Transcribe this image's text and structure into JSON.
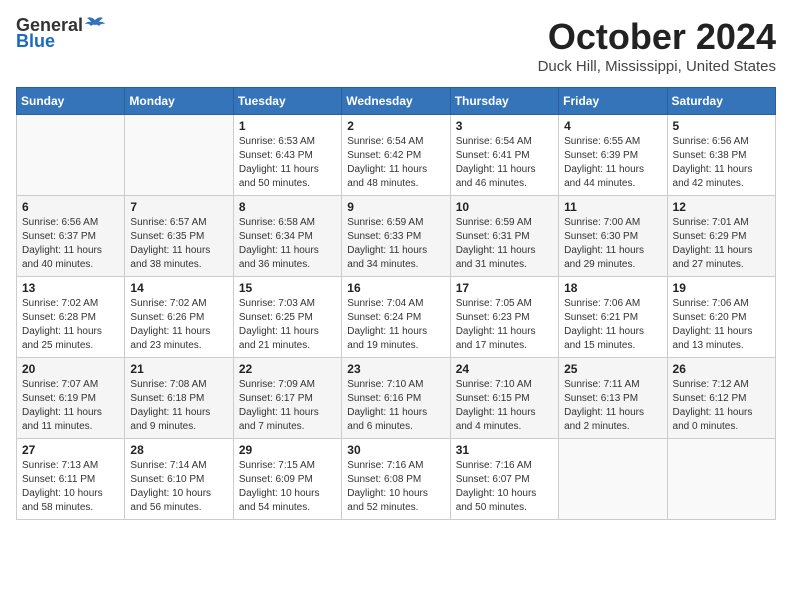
{
  "header": {
    "logo_general": "General",
    "logo_blue": "Blue",
    "month": "October 2024",
    "location": "Duck Hill, Mississippi, United States"
  },
  "weekdays": [
    "Sunday",
    "Monday",
    "Tuesday",
    "Wednesday",
    "Thursday",
    "Friday",
    "Saturday"
  ],
  "weeks": [
    [
      {
        "day": "",
        "info": ""
      },
      {
        "day": "",
        "info": ""
      },
      {
        "day": "1",
        "info": "Sunrise: 6:53 AM\nSunset: 6:43 PM\nDaylight: 11 hours and 50 minutes."
      },
      {
        "day": "2",
        "info": "Sunrise: 6:54 AM\nSunset: 6:42 PM\nDaylight: 11 hours and 48 minutes."
      },
      {
        "day": "3",
        "info": "Sunrise: 6:54 AM\nSunset: 6:41 PM\nDaylight: 11 hours and 46 minutes."
      },
      {
        "day": "4",
        "info": "Sunrise: 6:55 AM\nSunset: 6:39 PM\nDaylight: 11 hours and 44 minutes."
      },
      {
        "day": "5",
        "info": "Sunrise: 6:56 AM\nSunset: 6:38 PM\nDaylight: 11 hours and 42 minutes."
      }
    ],
    [
      {
        "day": "6",
        "info": "Sunrise: 6:56 AM\nSunset: 6:37 PM\nDaylight: 11 hours and 40 minutes."
      },
      {
        "day": "7",
        "info": "Sunrise: 6:57 AM\nSunset: 6:35 PM\nDaylight: 11 hours and 38 minutes."
      },
      {
        "day": "8",
        "info": "Sunrise: 6:58 AM\nSunset: 6:34 PM\nDaylight: 11 hours and 36 minutes."
      },
      {
        "day": "9",
        "info": "Sunrise: 6:59 AM\nSunset: 6:33 PM\nDaylight: 11 hours and 34 minutes."
      },
      {
        "day": "10",
        "info": "Sunrise: 6:59 AM\nSunset: 6:31 PM\nDaylight: 11 hours and 31 minutes."
      },
      {
        "day": "11",
        "info": "Sunrise: 7:00 AM\nSunset: 6:30 PM\nDaylight: 11 hours and 29 minutes."
      },
      {
        "day": "12",
        "info": "Sunrise: 7:01 AM\nSunset: 6:29 PM\nDaylight: 11 hours and 27 minutes."
      }
    ],
    [
      {
        "day": "13",
        "info": "Sunrise: 7:02 AM\nSunset: 6:28 PM\nDaylight: 11 hours and 25 minutes."
      },
      {
        "day": "14",
        "info": "Sunrise: 7:02 AM\nSunset: 6:26 PM\nDaylight: 11 hours and 23 minutes."
      },
      {
        "day": "15",
        "info": "Sunrise: 7:03 AM\nSunset: 6:25 PM\nDaylight: 11 hours and 21 minutes."
      },
      {
        "day": "16",
        "info": "Sunrise: 7:04 AM\nSunset: 6:24 PM\nDaylight: 11 hours and 19 minutes."
      },
      {
        "day": "17",
        "info": "Sunrise: 7:05 AM\nSunset: 6:23 PM\nDaylight: 11 hours and 17 minutes."
      },
      {
        "day": "18",
        "info": "Sunrise: 7:06 AM\nSunset: 6:21 PM\nDaylight: 11 hours and 15 minutes."
      },
      {
        "day": "19",
        "info": "Sunrise: 7:06 AM\nSunset: 6:20 PM\nDaylight: 11 hours and 13 minutes."
      }
    ],
    [
      {
        "day": "20",
        "info": "Sunrise: 7:07 AM\nSunset: 6:19 PM\nDaylight: 11 hours and 11 minutes."
      },
      {
        "day": "21",
        "info": "Sunrise: 7:08 AM\nSunset: 6:18 PM\nDaylight: 11 hours and 9 minutes."
      },
      {
        "day": "22",
        "info": "Sunrise: 7:09 AM\nSunset: 6:17 PM\nDaylight: 11 hours and 7 minutes."
      },
      {
        "day": "23",
        "info": "Sunrise: 7:10 AM\nSunset: 6:16 PM\nDaylight: 11 hours and 6 minutes."
      },
      {
        "day": "24",
        "info": "Sunrise: 7:10 AM\nSunset: 6:15 PM\nDaylight: 11 hours and 4 minutes."
      },
      {
        "day": "25",
        "info": "Sunrise: 7:11 AM\nSunset: 6:13 PM\nDaylight: 11 hours and 2 minutes."
      },
      {
        "day": "26",
        "info": "Sunrise: 7:12 AM\nSunset: 6:12 PM\nDaylight: 11 hours and 0 minutes."
      }
    ],
    [
      {
        "day": "27",
        "info": "Sunrise: 7:13 AM\nSunset: 6:11 PM\nDaylight: 10 hours and 58 minutes."
      },
      {
        "day": "28",
        "info": "Sunrise: 7:14 AM\nSunset: 6:10 PM\nDaylight: 10 hours and 56 minutes."
      },
      {
        "day": "29",
        "info": "Sunrise: 7:15 AM\nSunset: 6:09 PM\nDaylight: 10 hours and 54 minutes."
      },
      {
        "day": "30",
        "info": "Sunrise: 7:16 AM\nSunset: 6:08 PM\nDaylight: 10 hours and 52 minutes."
      },
      {
        "day": "31",
        "info": "Sunrise: 7:16 AM\nSunset: 6:07 PM\nDaylight: 10 hours and 50 minutes."
      },
      {
        "day": "",
        "info": ""
      },
      {
        "day": "",
        "info": ""
      }
    ]
  ]
}
